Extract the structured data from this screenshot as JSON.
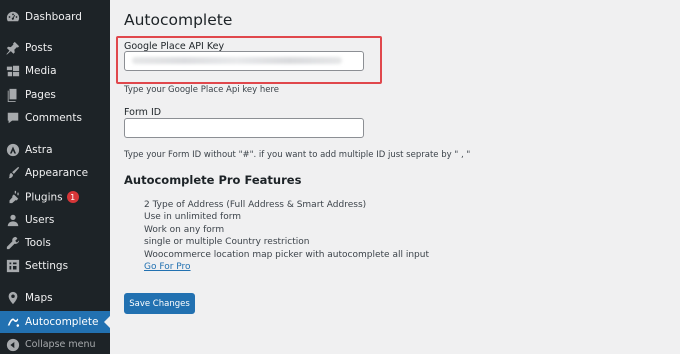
{
  "sidebar": {
    "items": [
      {
        "label": "Dashboard",
        "icon": "dashboard-icon"
      },
      {
        "label": "Posts",
        "icon": "pushpin-icon"
      },
      {
        "label": "Media",
        "icon": "media-icon"
      },
      {
        "label": "Pages",
        "icon": "pages-icon"
      },
      {
        "label": "Comments",
        "icon": "comment-icon"
      },
      {
        "label": "Astra",
        "icon": "astra-logo-icon"
      },
      {
        "label": "Appearance",
        "icon": "paintbrush-icon"
      },
      {
        "label": "Plugins",
        "icon": "plug-icon",
        "badge": "1"
      },
      {
        "label": "Users",
        "icon": "user-icon"
      },
      {
        "label": "Tools",
        "icon": "wrench-icon"
      },
      {
        "label": "Settings",
        "icon": "settings-icon"
      },
      {
        "label": "Maps",
        "icon": "map-marker-icon"
      },
      {
        "label": "Autocomplete",
        "icon": "autocomplete-icon",
        "current": true
      }
    ],
    "collapse_label": "Collapse menu"
  },
  "main": {
    "title": "Autocomplete",
    "api_key": {
      "label": "Google Place API Key",
      "value": "",
      "description": "Type your Google Place Api key here"
    },
    "form_id": {
      "label": "Form ID",
      "value": "",
      "description": "Type your Form ID without \"#\". if you want to add multiple ID just seprate by \" , \""
    },
    "pro": {
      "title": "Autocomplete Pro Features",
      "features": [
        "2 Type of Address (Full Address & Smart Address)",
        "Use in unlimited form",
        "Work on any form",
        "single or multiple Country restriction",
        "Woocommerce location map picker with autocomplete all input"
      ],
      "link": "Go For Pro"
    },
    "save_label": "Save Changes"
  },
  "colors": {
    "sidebar_bg": "#1d2327",
    "accent": "#2271b1",
    "highlight": "#e0474c",
    "badge": "#d63638"
  }
}
